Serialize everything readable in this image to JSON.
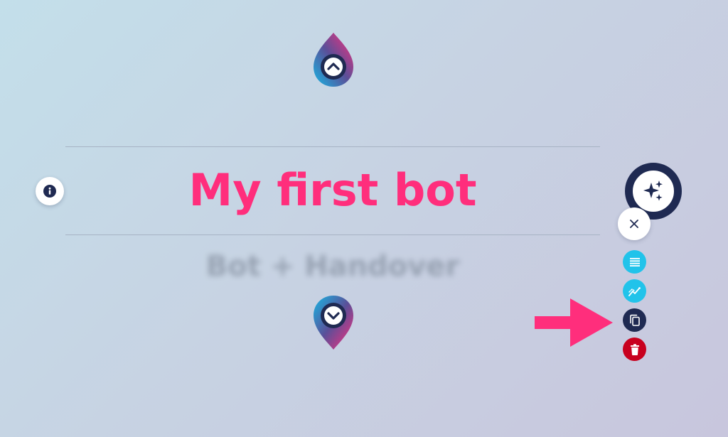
{
  "bot": {
    "title": "My first bot",
    "subtitle": "Bot + Handover"
  },
  "icons": {
    "nav_up": "chevron-up-pin-icon",
    "nav_down": "chevron-down-pin-icon",
    "info": "info-icon",
    "magic": "sparkles-icon",
    "close": "close-icon",
    "list": "list-icon",
    "stats": "analytics-icon",
    "copy": "copy-icon",
    "delete": "trash-icon",
    "pointer": "right-arrow-icon"
  },
  "colors": {
    "title": "#ff2e7c",
    "navy": "#1f2a52",
    "cyan": "#21c3ea",
    "danger": "#c8001e",
    "arrow": "#ff2e7c"
  }
}
